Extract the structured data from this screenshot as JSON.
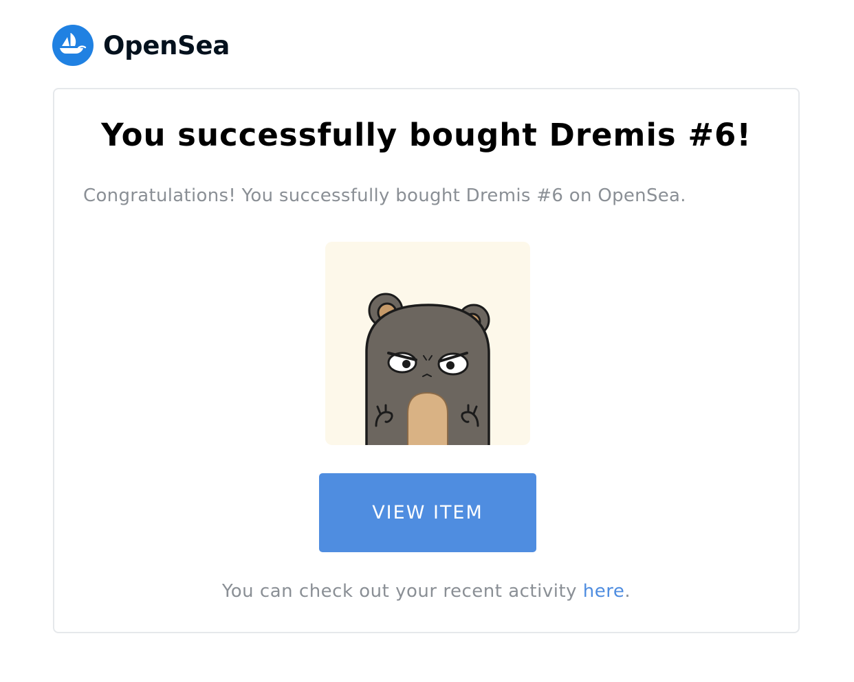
{
  "header": {
    "brand_name": "OpenSea",
    "logo_icon": "opensea-ship-logo",
    "logo_color": "#2081e2"
  },
  "card": {
    "title": "You successfully bought Dremis #6!",
    "message": "Congratulations! You successfully bought Dremis #6 on OpenSea.",
    "nft_image": {
      "icon": "dremis-bear-avatar",
      "background_color": "#fdf8ea"
    },
    "view_button_label": "VIEW ITEM",
    "button_color": "#4f8de0",
    "footer_text": "You can check out your recent activity ",
    "footer_link_text": "here",
    "footer_suffix": "."
  }
}
